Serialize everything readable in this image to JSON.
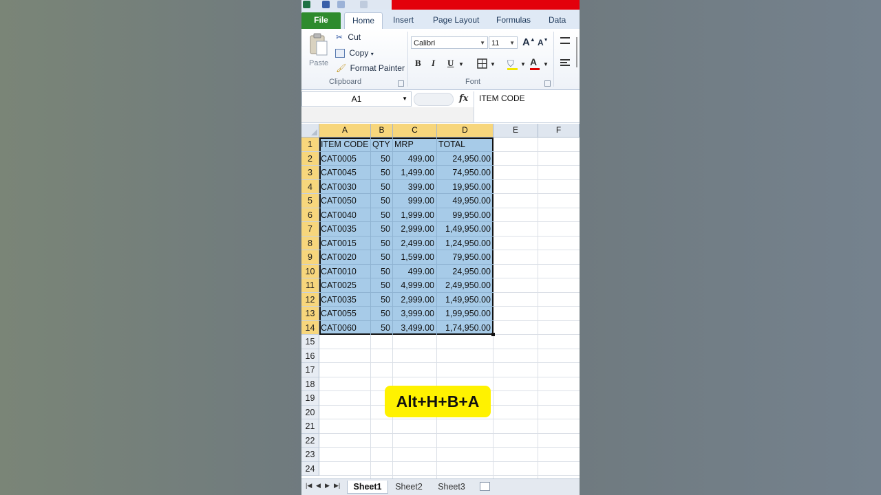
{
  "ribbon_tabs": [
    "File",
    "Home",
    "Insert",
    "Page Layout",
    "Formulas",
    "Data"
  ],
  "clipboard": {
    "paste": "Paste",
    "cut": "Cut",
    "copy": "Copy",
    "format_painter": "Format Painter",
    "group_label": "Clipboard"
  },
  "font": {
    "name": "Calibri",
    "size": "11",
    "bold": "B",
    "italic": "I",
    "underline": "U",
    "color_letter": "A",
    "group_label": "Font",
    "grow": "A",
    "shrink": "A"
  },
  "formula_bar": {
    "name_box": "A1",
    "fx": "fx",
    "content": "ITEM CODE"
  },
  "columns": [
    "A",
    "B",
    "C",
    "D",
    "E",
    "F"
  ],
  "rows": [
    "1",
    "2",
    "3",
    "4",
    "5",
    "6",
    "7",
    "8",
    "9",
    "10",
    "11",
    "12",
    "13",
    "14",
    "15",
    "16",
    "17",
    "18",
    "19",
    "20",
    "21",
    "22",
    "23",
    "24"
  ],
  "table": {
    "headers": [
      "ITEM CODE",
      "QTY",
      "MRP",
      "TOTAL"
    ],
    "rows": [
      [
        "CAT0005",
        "50",
        "499.00",
        "24,950.00"
      ],
      [
        "CAT0045",
        "50",
        "1,499.00",
        "74,950.00"
      ],
      [
        "CAT0030",
        "50",
        "399.00",
        "19,950.00"
      ],
      [
        "CAT0050",
        "50",
        "999.00",
        "49,950.00"
      ],
      [
        "CAT0040",
        "50",
        "1,999.00",
        "99,950.00"
      ],
      [
        "CAT0035",
        "50",
        "2,999.00",
        "1,49,950.00"
      ],
      [
        "CAT0015",
        "50",
        "2,499.00",
        "1,24,950.00"
      ],
      [
        "CAT0020",
        "50",
        "1,599.00",
        "79,950.00"
      ],
      [
        "CAT0010",
        "50",
        "499.00",
        "24,950.00"
      ],
      [
        "CAT0025",
        "50",
        "4,999.00",
        "2,49,950.00"
      ],
      [
        "CAT0035",
        "50",
        "2,999.00",
        "1,49,950.00"
      ],
      [
        "CAT0055",
        "50",
        "3,999.00",
        "1,99,950.00"
      ],
      [
        "CAT0060",
        "50",
        "3,499.00",
        "1,74,950.00"
      ]
    ]
  },
  "sheets": [
    "Sheet1",
    "Sheet2",
    "Sheet3"
  ],
  "callout": "Alt+H+B+A",
  "colors": {
    "selection": "#a7cbe8",
    "header_selected": "#f7d67c",
    "file_tab": "#2e8b2e",
    "callout": "#fff200"
  }
}
